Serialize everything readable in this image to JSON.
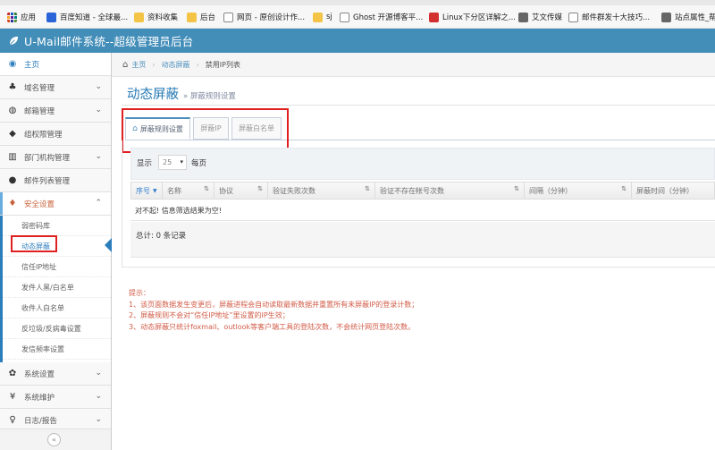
{
  "bookmarks": [
    {
      "label": "应用",
      "icon": "apps-grid-icon"
    },
    {
      "label": "百度知道 - 全球最...",
      "icon": "baidu-paw-icon"
    },
    {
      "label": "资料收集",
      "icon": "folder-icon"
    },
    {
      "label": "后台",
      "icon": "folder-icon"
    },
    {
      "label": "网页 - 原创设计作...",
      "icon": "page-icon"
    },
    {
      "label": "sj",
      "icon": "folder-icon"
    },
    {
      "label": "Ghost 开源博客平...",
      "icon": "ghost-icon"
    },
    {
      "label": "Linux下分区详解之...",
      "icon": "csdn-icon"
    },
    {
      "label": "艾文传媒",
      "icon": "gear-icon"
    },
    {
      "label": "邮件群发十大技巧...",
      "icon": "page-icon"
    },
    {
      "label": "站点属性_帮",
      "icon": "gear-icon"
    }
  ],
  "header": {
    "title": "U-Mail邮件系统--超级管理员后台",
    "color": "#438eb9"
  },
  "sidebar": {
    "items": [
      {
        "label": "主页",
        "icon": "dashboard-icon",
        "glyph": "◉"
      },
      {
        "label": "域名管理",
        "icon": "sitemap-icon",
        "glyph": "♣"
      },
      {
        "label": "邮箱管理",
        "icon": "globe-icon",
        "glyph": "◍"
      },
      {
        "label": "组权限管理",
        "icon": "tags-icon",
        "glyph": "◆"
      },
      {
        "label": "部门机构管理",
        "icon": "bar-chart-icon",
        "glyph": "▥"
      },
      {
        "label": "邮件列表管理",
        "icon": "user-icon",
        "glyph": "●"
      },
      {
        "label": "安全设置",
        "icon": "shield-icon",
        "glyph": "♦"
      }
    ],
    "submenu": [
      {
        "label": "弱密码库"
      },
      {
        "label": "动态屏蔽"
      },
      {
        "label": "信任IP地址"
      },
      {
        "label": "发件人黑/白名单"
      },
      {
        "label": "收件人白名单"
      },
      {
        "label": "反垃圾/反病毒设置"
      },
      {
        "label": "发信频率设置"
      }
    ],
    "bottom_items": [
      {
        "label": "系统设置",
        "icon": "cog-icon",
        "glyph": "✿"
      },
      {
        "label": "系统维护",
        "icon": "yen-icon",
        "glyph": "¥"
      },
      {
        "label": "日志/报告",
        "icon": "bulb-icon",
        "glyph": "♀"
      }
    ],
    "collapse_glyph": "«"
  },
  "breadcrumb": {
    "home": "主页",
    "section": "动态屏蔽",
    "current": "禁用IP列表"
  },
  "page": {
    "title": "动态屏蔽",
    "subtitle": "» 屏蔽规则设置"
  },
  "tabs": [
    {
      "label": "屏蔽规则设置",
      "active": true
    },
    {
      "label": "屏蔽IP",
      "active": false
    },
    {
      "label": "屏蔽白名单",
      "active": false
    }
  ],
  "toolbar": {
    "show_label": "显示",
    "page_size": "25",
    "per_page_label": "每页"
  },
  "table": {
    "columns": [
      "序号",
      "名称",
      "协议",
      "验证失败次数",
      "验证不存在帐号次数",
      "间隔（分钟）",
      "屏蔽时间（分钟）"
    ],
    "empty_message": "对不起! 信息筛选结果为空!",
    "total": "总计: 0 条记录"
  },
  "tips": {
    "title": "提示：",
    "lines": [
      "1、该页面数据发生变更后，屏蔽进程会自动读取最新数据并重置所有未屏蔽IP的登录计数；",
      "2、屏蔽规则不会对“信任IP地址”里设置的IP生效；",
      "3、动态屏蔽只统计foxmail、outlook等客户端工具的登陆次数，不会统计网页登陆次数。"
    ]
  }
}
